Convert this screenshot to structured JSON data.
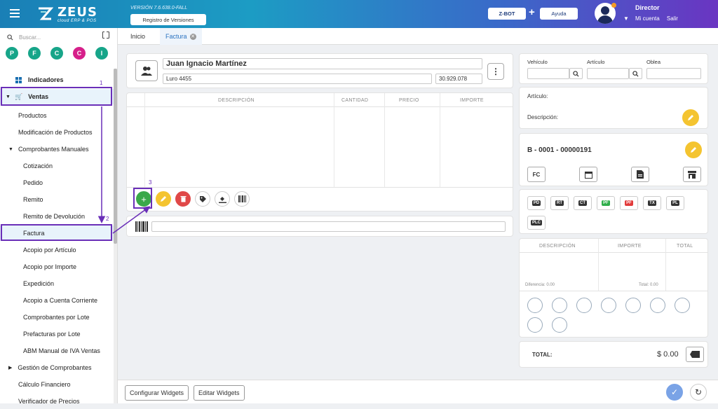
{
  "header": {
    "logo_text": "ZEUS",
    "logo_sub": "cloud ERP & POS",
    "version": "VERSIÓN 7.6.638.0-FALL",
    "registro": "Registro de Versiones",
    "zbot": "Z-BOT",
    "plus": "+",
    "ayuda": "Ayuda",
    "user_role": "Director",
    "mi_cuenta": "Mi cuenta",
    "salir": "Salir"
  },
  "sidebar": {
    "search_placeholder": "Buscar...",
    "favorites": [
      {
        "letter": "P",
        "color": "#17a589"
      },
      {
        "letter": "F",
        "color": "#17a589"
      },
      {
        "letter": "C",
        "color": "#17a589"
      },
      {
        "letter": "C",
        "color": "#d6208a"
      },
      {
        "letter": "I",
        "color": "#17a589"
      }
    ],
    "items": [
      {
        "label": "Indicadores",
        "bold": true
      },
      {
        "label": "Ventas",
        "bold": true
      },
      {
        "label": "Productos"
      },
      {
        "label": "Modificación de Productos"
      },
      {
        "label": "Comprobantes Manuales"
      },
      {
        "label": "Cotización"
      },
      {
        "label": "Pedido"
      },
      {
        "label": "Remito"
      },
      {
        "label": "Remito de Devolución"
      },
      {
        "label": "Factura"
      },
      {
        "label": "Acopio por Artículo"
      },
      {
        "label": "Acopio por Importe"
      },
      {
        "label": "Expedición"
      },
      {
        "label": "Acopio a Cuenta Corriente"
      },
      {
        "label": "Comprobantes por Lote"
      },
      {
        "label": "Prefacturas por Lote"
      },
      {
        "label": "ABM Manual de IVA Ventas"
      },
      {
        "label": "Gestión de Comprobantes"
      },
      {
        "label": "Cálculo Financiero"
      },
      {
        "label": "Verificador de Precios"
      }
    ]
  },
  "annotations": {
    "step1": "1",
    "step2": "2",
    "step3": "3"
  },
  "tabs": [
    {
      "label": "Inicio"
    },
    {
      "label": "Factura"
    }
  ],
  "client": {
    "name": "Juan Ignacio Martínez",
    "address": "Luro 4455",
    "cuit": "30.929.078"
  },
  "grid": {
    "columns": [
      "DESCRIPCIÓN",
      "CANTIDAD",
      "PRECIO",
      "IMPORTE"
    ]
  },
  "search_panel": {
    "vehiculo": "Vehículo",
    "articulo": "Artículo",
    "oblea": "Oblea"
  },
  "article_info": {
    "articulo": "Artículo:",
    "descripcion": "Descripción:"
  },
  "comprobante": {
    "number": "B - 0001 - 00000191",
    "type": "FC"
  },
  "doc_types": [
    "PD",
    "RT",
    "CT",
    "PF",
    "PF",
    "TX",
    "PL",
    "PLC"
  ],
  "payments": {
    "columns": [
      "DESCRIPCIÓN",
      "IMPORTE",
      "TOTAL"
    ],
    "diferencia": "Diferencia: 0.00",
    "total_small": "Total: 0.00"
  },
  "totals": {
    "label": "TOTAL:",
    "value": "$ 0.00"
  },
  "bottom": {
    "configurar": "Configurar Widgets",
    "editar": "Editar Widgets"
  }
}
